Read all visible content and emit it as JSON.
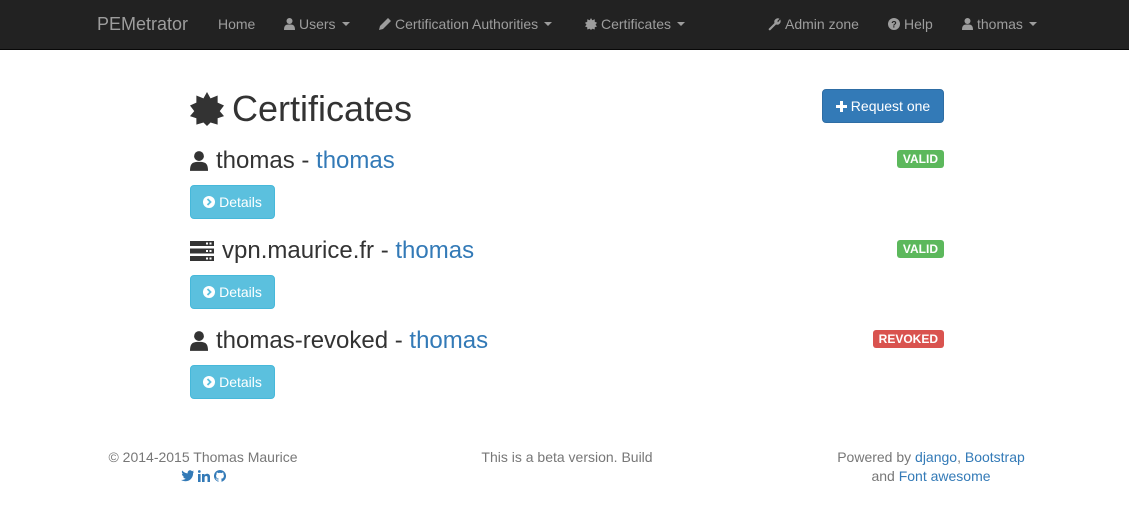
{
  "navbar": {
    "brand": "PEMetrator",
    "home": "Home",
    "users": "Users",
    "certification_authorities": "Certification Authorities",
    "certificates": "Certificates",
    "admin_zone": "Admin zone",
    "help": "Help",
    "user": "thomas"
  },
  "main": {
    "title": "Certificates",
    "request_button": "Request one",
    "certificates": [
      {
        "name": "thomas",
        "separator": " - ",
        "owner": "thomas",
        "status": "VALID",
        "icon": "user-icon",
        "details_label": "Details"
      },
      {
        "name": "vpn.maurice.fr",
        "separator": " - ",
        "owner": "thomas",
        "status": "VALID",
        "icon": "server-icon",
        "details_label": "Details"
      },
      {
        "name": "thomas-revoked",
        "separator": " - ",
        "owner": "thomas",
        "status": "REVOKED",
        "icon": "user-icon",
        "details_label": "Details"
      }
    ]
  },
  "footer": {
    "copyright": "© 2014-2015 Thomas Maurice",
    "beta_notice": "This is a beta version. Build",
    "powered_by": "Powered by",
    "django": "django",
    "comma": ",",
    "bootstrap": "Bootstrap",
    "and": "and",
    "font_awesome": "Font awesome"
  },
  "colors": {
    "navbar_bg": "#222222",
    "primary": "#337ab7",
    "info": "#5bc0de",
    "success": "#5cb85c",
    "danger": "#d9534f"
  }
}
